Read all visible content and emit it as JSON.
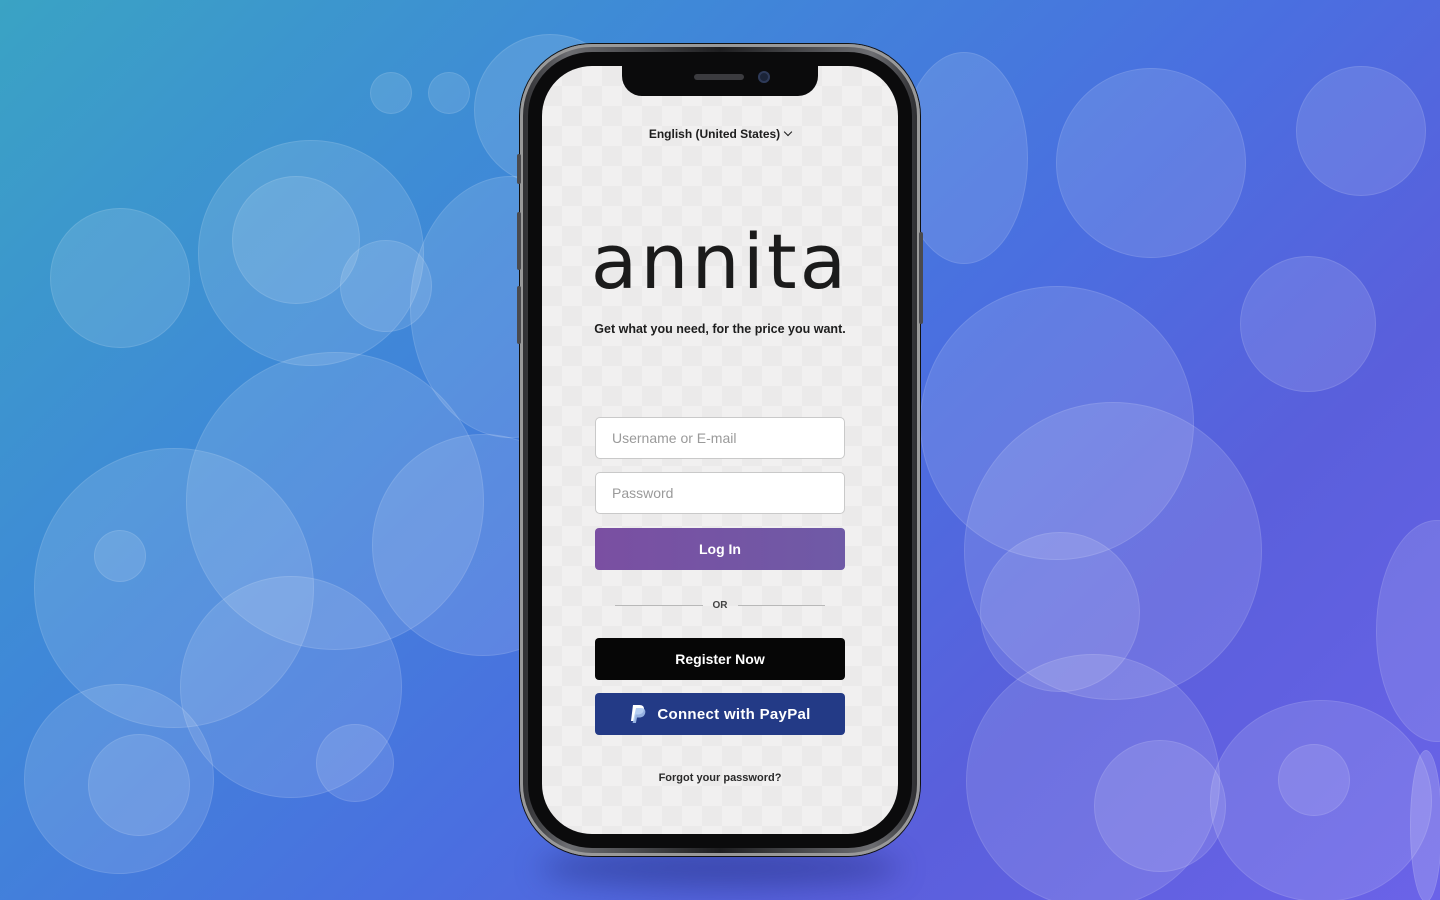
{
  "app": {
    "language_selector": "English (United States)",
    "logo_text": "annita",
    "tagline": "Get what you need, for the price you want."
  },
  "form": {
    "username_placeholder": "Username or E-mail",
    "password_placeholder": "Password",
    "login_label": "Log In",
    "divider_label": "OR",
    "register_label": "Register Now",
    "paypal_label": "Connect with PayPal",
    "forgot_label": "Forgot your password?"
  },
  "colors": {
    "login_button": "#7a4fa2",
    "register_button": "#060606",
    "paypal_button": "#233a86",
    "screen_background": "#f1f0f0"
  },
  "icons": {
    "language": "chevron-down-icon",
    "paypal": "paypal-icon"
  }
}
